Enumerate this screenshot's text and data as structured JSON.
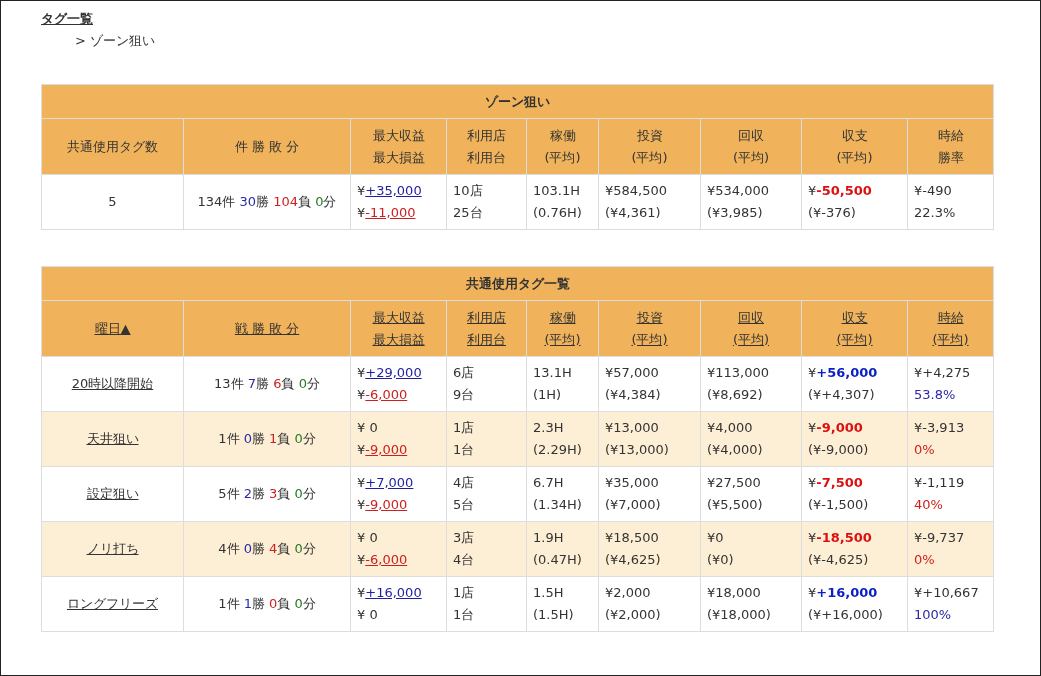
{
  "breadcrumb": {
    "root": "タグ一覧",
    "current": "> ゾーン狙い"
  },
  "summary_table": {
    "title": "ゾーン狙い",
    "headers": [
      {
        "lines": [
          "共通使用タグ数"
        ]
      },
      {
        "lines": [
          "件 勝 敗 分"
        ]
      },
      {
        "lines": [
          "最大収益",
          "最大損益"
        ]
      },
      {
        "lines": [
          "利用店",
          "利用台"
        ]
      },
      {
        "lines": [
          "稼働",
          "(平均)"
        ]
      },
      {
        "lines": [
          "投資",
          "(平均)"
        ]
      },
      {
        "lines": [
          "回収",
          "(平均)"
        ]
      },
      {
        "lines": [
          "収支",
          "(平均)"
        ]
      },
      {
        "lines": [
          "時給",
          "勝率"
        ]
      }
    ],
    "rows": [
      {
        "cells": [
          {
            "kind": "text",
            "text": "5"
          },
          {
            "kind": "record",
            "parts": [
              {
                "text": "134件 "
              },
              {
                "text": "30",
                "color": "#2a2aa8"
              },
              {
                "text": "勝 "
              },
              {
                "text": "104",
                "color": "#d02020"
              },
              {
                "text": "負 "
              },
              {
                "text": "0",
                "color": "#237a23"
              },
              {
                "text": "分"
              }
            ]
          },
          {
            "kind": "amounts",
            "lines": [
              {
                "prefix": "¥",
                "amount": "+35,000",
                "color": "#1f1fa0"
              },
              {
                "prefix": "¥",
                "amount": "-11,000",
                "color": "#cc2020"
              }
            ]
          },
          {
            "kind": "lines",
            "lines": [
              "10店",
              "25台"
            ]
          },
          {
            "kind": "lines",
            "lines": [
              "103.1H",
              "(0.76H)"
            ]
          },
          {
            "kind": "lines",
            "lines": [
              "¥584,500",
              "(¥4,361)"
            ]
          },
          {
            "kind": "lines",
            "lines": [
              "¥534,000",
              "(¥3,985)"
            ]
          },
          {
            "kind": "balance",
            "prefix": "¥",
            "amount": "-50,500",
            "color": "#dd1010",
            "average": "(¥-376)"
          },
          {
            "kind": "wage",
            "hourly": "¥-490",
            "rate": "22.3%"
          }
        ]
      }
    ]
  },
  "tag_table": {
    "title": "共通使用タグ一覧",
    "headers": [
      {
        "lines": [
          "曜日▲"
        ]
      },
      {
        "lines": [
          "戦 勝 敗 分"
        ]
      },
      {
        "lines": [
          "最大収益",
          "最大損益"
        ]
      },
      {
        "lines": [
          "利用店",
          "利用台"
        ]
      },
      {
        "lines": [
          "稼働",
          "(平均)"
        ]
      },
      {
        "lines": [
          "投資",
          "(平均)"
        ]
      },
      {
        "lines": [
          "回収",
          "(平均)"
        ]
      },
      {
        "lines": [
          "収支",
          "(平均)"
        ]
      },
      {
        "lines": [
          "時給",
          "(平均)"
        ]
      }
    ],
    "rows": [
      {
        "cells": [
          {
            "kind": "name",
            "text": "20時以降開始"
          },
          {
            "kind": "record",
            "parts": [
              {
                "text": "13件 "
              },
              {
                "text": "7",
                "color": "#2a2aa8"
              },
              {
                "text": "勝 "
              },
              {
                "text": "6",
                "color": "#d02020"
              },
              {
                "text": "負 "
              },
              {
                "text": "0",
                "color": "#237a23"
              },
              {
                "text": "分"
              }
            ]
          },
          {
            "kind": "amounts",
            "lines": [
              {
                "prefix": "¥",
                "amount": "+29,000",
                "color": "#1f1fa0"
              },
              {
                "prefix": "¥",
                "amount": "-6,000",
                "color": "#cc2020"
              }
            ]
          },
          {
            "kind": "lines",
            "lines": [
              "6店",
              "9台"
            ]
          },
          {
            "kind": "lines",
            "lines": [
              "13.1H",
              "(1H)"
            ]
          },
          {
            "kind": "lines",
            "lines": [
              "¥57,000",
              "(¥4,384)"
            ]
          },
          {
            "kind": "lines",
            "lines": [
              "¥113,000",
              "(¥8,692)"
            ]
          },
          {
            "kind": "balance",
            "prefix": "¥",
            "amount": "+56,000",
            "color": "#0a1fc4",
            "average": "(¥+4,307)"
          },
          {
            "kind": "wage",
            "hourly": "¥+4,275",
            "rate": "53.8%",
            "color": "#2a2aa8"
          }
        ]
      },
      {
        "cells": [
          {
            "kind": "name",
            "text": "天井狙い"
          },
          {
            "kind": "record",
            "parts": [
              {
                "text": "1件 "
              },
              {
                "text": "0",
                "color": "#2a2aa8"
              },
              {
                "text": "勝 "
              },
              {
                "text": "1",
                "color": "#d02020"
              },
              {
                "text": "負 "
              },
              {
                "text": "0",
                "color": "#237a23"
              },
              {
                "text": "分"
              }
            ]
          },
          {
            "kind": "amounts",
            "lines": [
              {
                "prefix": "¥ 0"
              },
              {
                "prefix": "¥",
                "amount": "-9,000",
                "color": "#cc2020"
              }
            ]
          },
          {
            "kind": "lines",
            "lines": [
              "1店",
              "1台"
            ]
          },
          {
            "kind": "lines",
            "lines": [
              "2.3H",
              "(2.29H)"
            ]
          },
          {
            "kind": "lines",
            "lines": [
              "¥13,000",
              "(¥13,000)"
            ]
          },
          {
            "kind": "lines",
            "lines": [
              "¥4,000",
              "(¥4,000)"
            ]
          },
          {
            "kind": "balance",
            "prefix": "¥",
            "amount": "-9,000",
            "color": "#dd1010",
            "average": "(¥-9,000)"
          },
          {
            "kind": "wage",
            "hourly": "¥-3,913",
            "rate": "0%",
            "color": "#d02020"
          }
        ]
      },
      {
        "cells": [
          {
            "kind": "name",
            "text": "設定狙い"
          },
          {
            "kind": "record",
            "parts": [
              {
                "text": "5件 "
              },
              {
                "text": "2",
                "color": "#2a2aa8"
              },
              {
                "text": "勝 "
              },
              {
                "text": "3",
                "color": "#d02020"
              },
              {
                "text": "負 "
              },
              {
                "text": "0",
                "color": "#237a23"
              },
              {
                "text": "分"
              }
            ]
          },
          {
            "kind": "amounts",
            "lines": [
              {
                "prefix": "¥",
                "amount": "+7,000",
                "color": "#1f1fa0"
              },
              {
                "prefix": "¥",
                "amount": "-9,000",
                "color": "#cc2020"
              }
            ]
          },
          {
            "kind": "lines",
            "lines": [
              "4店",
              "5台"
            ]
          },
          {
            "kind": "lines",
            "lines": [
              "6.7H",
              "(1.34H)"
            ]
          },
          {
            "kind": "lines",
            "lines": [
              "¥35,000",
              "(¥7,000)"
            ]
          },
          {
            "kind": "lines",
            "lines": [
              "¥27,500",
              "(¥5,500)"
            ]
          },
          {
            "kind": "balance",
            "prefix": "¥",
            "amount": "-7,500",
            "color": "#dd1010",
            "average": "(¥-1,500)"
          },
          {
            "kind": "wage",
            "hourly": "¥-1,119",
            "rate": "40%",
            "color": "#d02020"
          }
        ]
      },
      {
        "cells": [
          {
            "kind": "name",
            "text": "ノリ打ち"
          },
          {
            "kind": "record",
            "parts": [
              {
                "text": "4件 "
              },
              {
                "text": "0",
                "color": "#2a2aa8"
              },
              {
                "text": "勝 "
              },
              {
                "text": "4",
                "color": "#d02020"
              },
              {
                "text": "負 "
              },
              {
                "text": "0",
                "color": "#237a23"
              },
              {
                "text": "分"
              }
            ]
          },
          {
            "kind": "amounts",
            "lines": [
              {
                "prefix": "¥ 0"
              },
              {
                "prefix": "¥",
                "amount": "-6,000",
                "color": "#cc2020"
              }
            ]
          },
          {
            "kind": "lines",
            "lines": [
              "3店",
              "4台"
            ]
          },
          {
            "kind": "lines",
            "lines": [
              "1.9H",
              "(0.47H)"
            ]
          },
          {
            "kind": "lines",
            "lines": [
              "¥18,500",
              "(¥4,625)"
            ]
          },
          {
            "kind": "lines",
            "lines": [
              "¥0",
              "(¥0)"
            ]
          },
          {
            "kind": "balance",
            "prefix": "¥",
            "amount": "-18,500",
            "color": "#dd1010",
            "average": "(¥-4,625)"
          },
          {
            "kind": "wage",
            "hourly": "¥-9,737",
            "rate": "0%",
            "color": "#d02020"
          }
        ]
      },
      {
        "cells": [
          {
            "kind": "name",
            "text": "ロングフリーズ"
          },
          {
            "kind": "record",
            "parts": [
              {
                "text": "1件 "
              },
              {
                "text": "1",
                "color": "#2a2aa8"
              },
              {
                "text": "勝 "
              },
              {
                "text": "0",
                "color": "#d02020"
              },
              {
                "text": "負 "
              },
              {
                "text": "0",
                "color": "#237a23"
              },
              {
                "text": "分"
              }
            ]
          },
          {
            "kind": "amounts",
            "lines": [
              {
                "prefix": "¥",
                "amount": "+16,000",
                "color": "#1f1fa0"
              },
              {
                "prefix": "¥ 0"
              }
            ]
          },
          {
            "kind": "lines",
            "lines": [
              "1店",
              "1台"
            ]
          },
          {
            "kind": "lines",
            "lines": [
              "1.5H",
              "(1.5H)"
            ]
          },
          {
            "kind": "lines",
            "lines": [
              "¥2,000",
              "(¥2,000)"
            ]
          },
          {
            "kind": "lines",
            "lines": [
              "¥18,000",
              "(¥18,000)"
            ]
          },
          {
            "kind": "balance",
            "prefix": "¥",
            "amount": "+16,000",
            "color": "#0a1fc4",
            "average": "(¥+16,000)"
          },
          {
            "kind": "wage",
            "hourly": "¥+10,667",
            "rate": "100%",
            "color": "#2a2aa8"
          }
        ]
      }
    ]
  }
}
